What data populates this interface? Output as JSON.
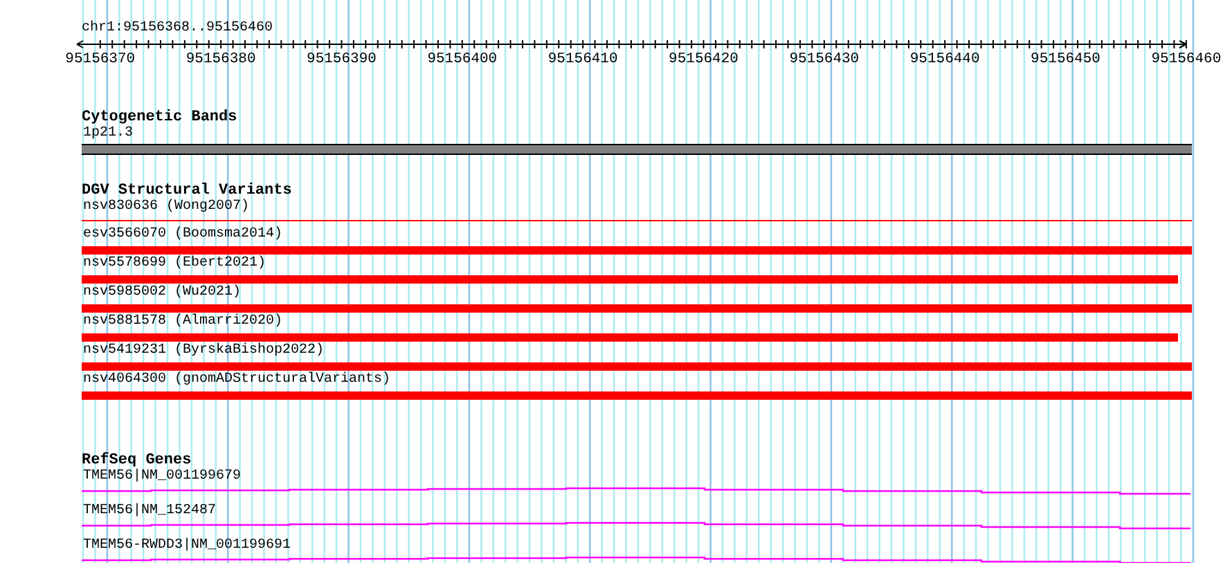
{
  "ruler": {
    "location": "chr1:95156368..95156460",
    "ticks": [
      "95156370",
      "95156380",
      "95156390",
      "95156400",
      "95156410",
      "95156420",
      "95156430",
      "95156440",
      "95156450",
      "95156460"
    ]
  },
  "cytogenetic_bands": {
    "title": "Cytogenetic Bands",
    "band": "1p21.3"
  },
  "dgv_structural_variants": {
    "title": "DGV Structural Variants",
    "items": [
      {
        "label": "nsv830636 (Wong2007)",
        "kind": "line",
        "reaches_end": true
      },
      {
        "label": "esv3566070 (Boomsma2014)",
        "kind": "bar",
        "reaches_end": true
      },
      {
        "label": "nsv5578699 (Ebert2021)",
        "kind": "bar",
        "reaches_end": false
      },
      {
        "label": "nsv5985002 (Wu2021)",
        "kind": "bar",
        "reaches_end": true
      },
      {
        "label": "nsv5881578 (Almarri2020)",
        "kind": "bar",
        "reaches_end": false
      },
      {
        "label": "nsv5419231 (ByrskaBishop2022)",
        "kind": "bar",
        "reaches_end": true
      },
      {
        "label": "nsv4064300 (gnomADStructuralVariants)",
        "kind": "bar",
        "reaches_end": true
      }
    ]
  },
  "refseq_genes": {
    "title": "RefSeq Genes",
    "items": [
      {
        "label": "TMEM56|NM_001199679"
      },
      {
        "label": "TMEM56|NM_152487"
      },
      {
        "label": "TMEM56-RWDD3|NM_001199691"
      }
    ]
  }
}
